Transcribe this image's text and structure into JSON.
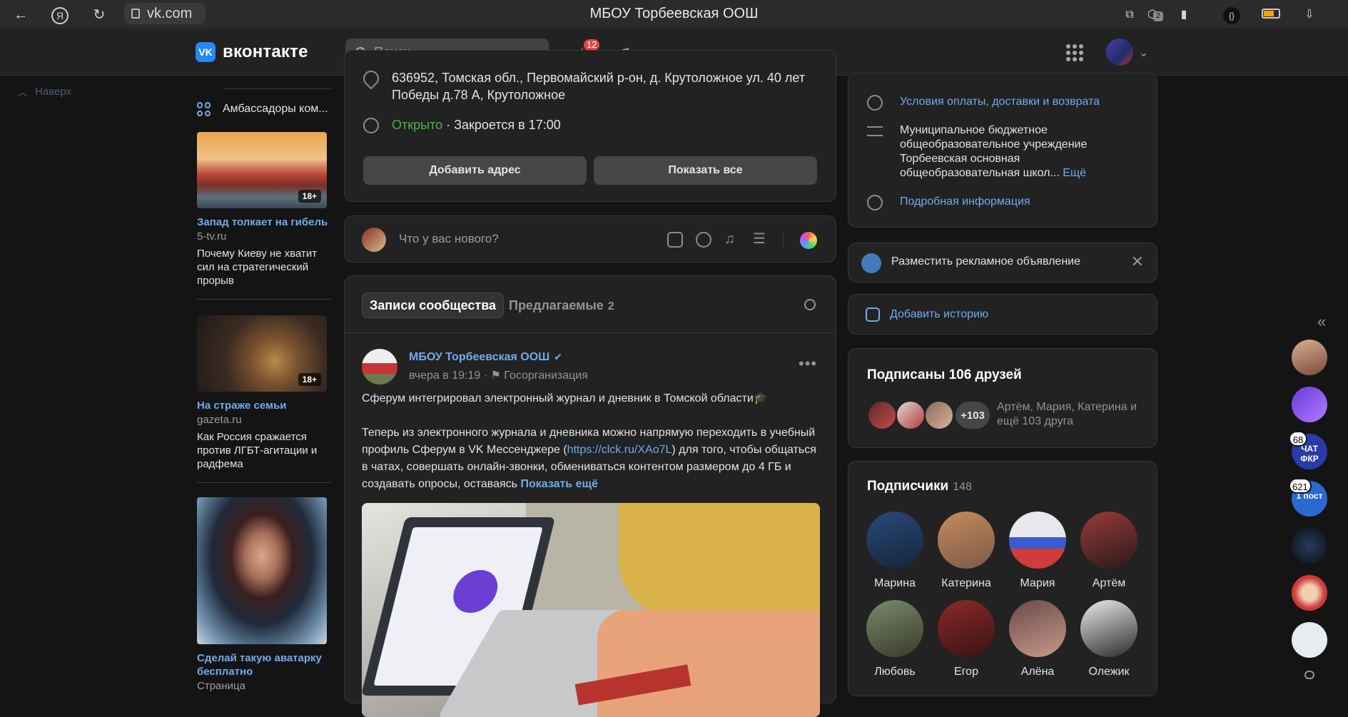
{
  "browser": {
    "url": "vk.com",
    "title": "МБОУ Торбеевская ООШ",
    "tabs_badge": "2"
  },
  "header": {
    "logo_text": "вконтакте",
    "logo_mark": "VK",
    "search_placeholder": "Поиск",
    "notifications_count": "12"
  },
  "left": {
    "up_label": "Наверх",
    "ambassadors": "Амбассадоры ком...",
    "ads": [
      {
        "title": "Запад толкает на гибель",
        "domain": "5-tv.ru",
        "text": "Почему Киеву не хватит сил на стратегический прорыв",
        "age": "18+"
      },
      {
        "title": "На страже семьи",
        "domain": "gazeta.ru",
        "text": "Как Россия сражается против ЛГБТ-агитации и радфема",
        "age": "18+"
      },
      {
        "title": "Сделай такую аватарку бесплатно",
        "domain": "Страница"
      }
    ]
  },
  "address": {
    "text": "636952, Томская обл., Первомайский р-он, д. Крутоложное ул. 40 лет Победы д.78 А, Крутоложное",
    "open": "Открыто",
    "close": "· Закроется в 17:00",
    "add_btn": "Добавить адрес",
    "show_btn": "Показать все"
  },
  "composer": {
    "placeholder": "Что у вас нового?"
  },
  "feed": {
    "tab_active": "Записи сообщества",
    "tab_suggested": "Предлагаемые",
    "suggested_count": "2",
    "post": {
      "author": "МБОУ Торбеевская ООШ",
      "time": "вчера в 19:19",
      "org": "Госорганизация",
      "line1": "Сферум интегрировал электронный журнал и дневник в Томской области🎓",
      "line2a": "Теперь из электронного журнала и дневника можно напрямую переходить в учебный профиль Сферум в VK Мессенджере (",
      "link": "https://clck.ru/XAo7L",
      "line2b": ") для того, чтобы общаться в чатах, совершать онлайн-звонки, обмениваться контентом размером до 4 ГБ и создавать опросы, оставаясь ",
      "more": "Показать ещё"
    }
  },
  "right": {
    "terms": "Условия оплаты, доставки и возврата",
    "about": "Муниципальное бюджетное общеобразовательное учреждение Торбеевская основная общеобразовательная школ...",
    "about_more": "Ещё",
    "details": "Подробная информация",
    "promo": "Разместить рекламное объявление",
    "story": "Добавить историю",
    "friends_title": "Подписаны 106 друзей",
    "friends_more": "+103",
    "friends_names": "Артём, Мария, Катерина и ещё 103 друга",
    "subs_title": "Подписчики",
    "subs_count": "148",
    "subs": [
      "Марина",
      "Катерина",
      "Мария",
      "Артём",
      "Любовь",
      "Егор",
      "Алёна",
      "Олежик"
    ]
  },
  "rail": {
    "counts": [
      "68",
      "621"
    ],
    "labels": [
      "ЧАТ ФКР",
      "1 пост"
    ]
  }
}
